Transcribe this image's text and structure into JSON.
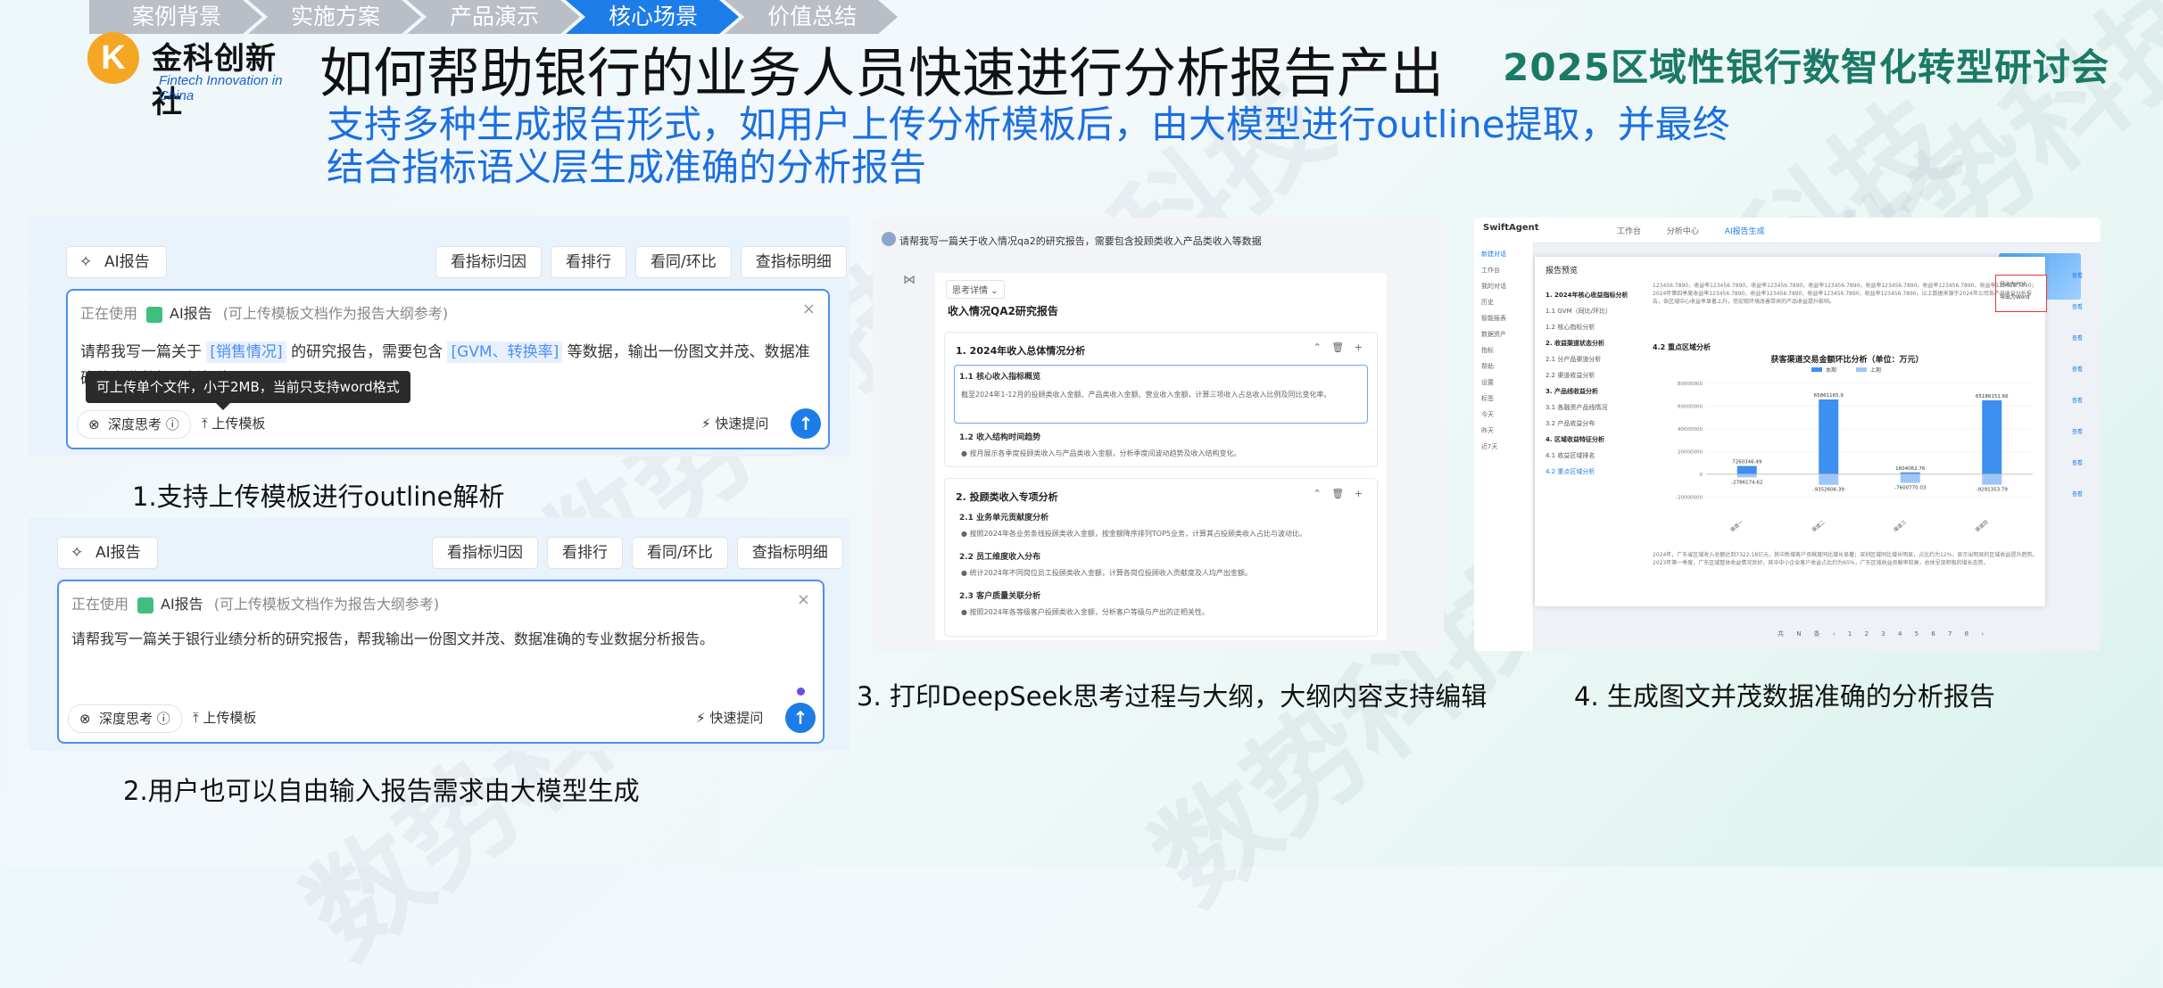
{
  "nav": [
    "案例背景",
    "实施方案",
    "产品演示",
    "核心场景",
    "价值总结"
  ],
  "nav_active": 3,
  "logo": {
    "mark": "K",
    "cn": "金科创新社",
    "en": "Fintech Innovation in China"
  },
  "title": "如何帮助银行的业务人员快速进行分析报告产出",
  "event": "2025区域性银行数智化转型研讨会",
  "subtitle": "支持多种生成报告形式，如用户上传分析模板后，由大模型进行outline提取，并最终结合指标语义层生成准确的分析报告",
  "watermark": "数势科技",
  "panel1": {
    "ai_tag": "AI报告",
    "quick_buttons": [
      "看指标归因",
      "看排行",
      "看同/环比",
      "查指标明细"
    ],
    "using_label": "正在使用",
    "agent_name": "AI报告",
    "agent_hint": "(可上传模板文档作为报告大纲参考)",
    "close": "×",
    "prompt_pre": "请帮我写一篇关于",
    "prompt_tag1": "[销售情况]",
    "prompt_mid": "的研究报告，需要包含",
    "prompt_tag2": "[GVM、转换率]",
    "prompt_post": "等数据，输出一份图文并茂、数据准确的专业数据分析报告",
    "tooltip": "可上传单个文件，小于2MB，当前只支持word格式",
    "deep_think": "深度思考",
    "upload": "上传模板",
    "quick_ask": "快速提问",
    "send_icon": "↑"
  },
  "caption1": "1.支持上传模板进行outline解析",
  "panel2": {
    "ai_tag": "AI报告",
    "quick_buttons": [
      "看指标归因",
      "看排行",
      "看同/环比",
      "查指标明细"
    ],
    "using_label": "正在使用",
    "agent_name": "AI报告",
    "agent_hint": "(可上传模板文档作为报告大纲参考)",
    "close": "×",
    "prompt": "请帮我写一篇关于银行业绩分析的研究报告，帮我输出一份图文并茂、数据准确的专业数据分析报告。",
    "deep_think": "深度思考",
    "upload": "上传模板",
    "quick_ask": "快速提问",
    "send_icon": "↑"
  },
  "caption2": "2.用户也可以自由输入报告需求由大模型生成",
  "panel3": {
    "question": "请帮我写一篇关于收入情况qa2的研究报告，需要包含投顾类收入产品类收入等数据",
    "dropdown": "思考详情 ⌄",
    "doc_title": "收入情况QA2研究报告",
    "card1": {
      "title": "1. 2024年收入总体情况分析",
      "ops": "⌃ 🗑 +",
      "s1": "1.1 核心收入指标概览",
      "t1": "截至2024年1-12月的投顾类收入金额、产品类收入金额、营业收入金额，计算三项收入占总收入比例及同比变化率。",
      "s2": "1.2 收入结构时间趋势",
      "t2": "● 按月展示各季度投顾类收入与产品类收入金额，分析季度间波动趋势及收入结构变化。"
    },
    "card2": {
      "title": "2. 投顾类收入专项分析",
      "ops": "⌃ 🗑 +",
      "s1": "2.1 业务单元贡献度分析",
      "t1": "● 按照2024年各业务条线投顾类收入金额，按金额降序排列TOP5业务，计算其占投顾类收入占比与波动比。",
      "s2": "2.2 员工维度收入分布",
      "t2": "● 统计2024年不同岗位员工投顾类收入金额，计算各岗位投顾收入贡献度及人均产出金额。",
      "s3": "2.3 客户质量关联分析",
      "t3": "● 按照2024年各等级客户投顾类收入金额，分析客户等级与产出的正相关性。"
    }
  },
  "caption3": "3. 打印DeepSeek思考过程与大纲，大纲内容支持编辑",
  "panel4": {
    "brand": "SwiftAgent",
    "tabs": [
      "工作台",
      "分析中心",
      "AI报告生成"
    ],
    "side_items": [
      "新建对话",
      "工作台",
      "我的对话",
      "历史",
      "智能报表",
      "数据资产",
      "指标",
      "帮助",
      "设置",
      "标签",
      "今天",
      "昨天",
      "近7天"
    ],
    "report_title": "报告预览",
    "toc": [
      {
        "t": "1. 2024年核心收益指标分析",
        "c": "b"
      },
      {
        "t": "1.1 GVM（同比/环比）",
        "c": ""
      },
      {
        "t": "1.2 核心指标分析",
        "c": ""
      },
      {
        "t": "2. 收益渠道状态分析",
        "c": "b"
      },
      {
        "t": "2.1 分产品渠道分析",
        "c": ""
      },
      {
        "t": "2.2 渠道收益分析",
        "c": ""
      },
      {
        "t": "3. 产品线收益分析",
        "c": "b"
      },
      {
        "t": "3.1 各融资产品线情况",
        "c": ""
      },
      {
        "t": "3.2 产品收益分布",
        "c": ""
      },
      {
        "t": "4. 区域收益特征分析",
        "c": "b"
      },
      {
        "t": "4.1 收益区域排名",
        "c": ""
      },
      {
        "t": "4.2 重点区域分析",
        "c": "c"
      }
    ],
    "para1": "123456.7890，收益率123456.7890，收益率123456.7890，收益率123456.7890，收益率123456.7890，收益率123456.7890，收益率123456.7890；2024年第四季度收益率123456.7890，收益率123456.7890，收益率123456.7890，收益率123456.7890。以上数据来源于2024年公司各产品收益分析报告，各区域中心收益率显著上升，受宏观环境改善带来的产品收益提升影响。",
    "section": "4.2 重点区域分析",
    "export": [
      "导出为PDF",
      "导出为Word"
    ],
    "links": [
      "查看",
      "查看",
      "查看",
      "查看",
      "查看",
      "查看",
      "查看",
      "查看"
    ],
    "para2": "2024年，广东省区域收入总额达到7322.18亿元，其中新增客户贡献度同比增长显著；深圳区域同比增长明显，占比约为12%，显示出明显的区域收益提升趋势。2023年第一季度，广东区域整体收益情况良好，其中中小企业客户收益占比约为65%，广东区域收益贡献率较高，总体呈现积极的增长态势。",
    "pager": "共 N 条  ‹ 1 2 3 4 5 6 7 8 ›"
  },
  "chart_data": {
    "type": "bar",
    "title": "获客渠道交易金额环比分析（单位：万元）",
    "legend": [
      "本期",
      "上期"
    ],
    "categories": [
      "渠道一",
      "渠道二",
      "渠道三",
      "渠道四"
    ],
    "series": [
      {
        "name": "本期",
        "values": [
          7260346.49,
          65861165.9,
          1604062.76,
          65186151.66
        ]
      },
      {
        "name": "上期",
        "values": [
          -2786174.62,
          -9352606.39,
          -7600770.03,
          -9291353.79
        ]
      }
    ],
    "data_labels": [
      "7260346.49",
      "65861165.9",
      "1604062.76",
      "65186151.66"
    ],
    "ylim": [
      -30000000,
      80000000
    ],
    "yticks": [
      "80000000",
      "60000000",
      "40000000",
      "20000000",
      "0",
      "-20000000"
    ]
  },
  "caption4": "4. 生成图文并茂数据准确的分析报告"
}
